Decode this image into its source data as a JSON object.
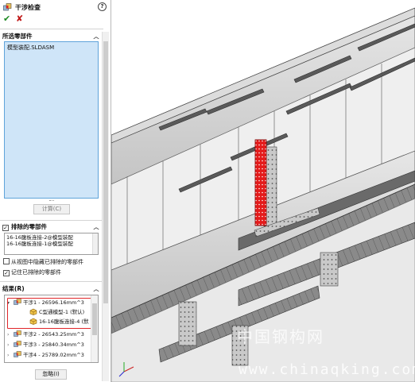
{
  "panel": {
    "title": "干涉检查",
    "help": "?",
    "ok_icon": "check-icon",
    "cancel_icon": "close-icon",
    "selected_parts": {
      "heading": "所选零部件",
      "items": [
        "模型装配.SLDASM"
      ],
      "calc_label": "计算(C)"
    },
    "excluded": {
      "heading": "排除的零部件",
      "checked": true,
      "items": [
        "16-16腹板连接-2@模型装配",
        "16-16腹板连接-1@模型装配"
      ],
      "hide_label": "从视图中隐藏已排除的零部件",
      "hide_checked": false,
      "remember_label": "记住已排除的零部件",
      "remember_checked": true
    },
    "results": {
      "heading": "结果(R)",
      "items": [
        {
          "toggle": "▾",
          "label": "干涉1 - 26596.16mm^3",
          "icon": "interference-icon"
        },
        {
          "toggle": "",
          "label": "C型通模型-1 (默认)",
          "icon": "part-icon"
        },
        {
          "toggle": "",
          "label": "16-16腹板连接-4 (默",
          "icon": "part-icon"
        },
        {
          "toggle": "›",
          "label": "干涉2 - 26543.25mm^3",
          "icon": "interference-icon"
        },
        {
          "toggle": "›",
          "label": "干涉3 - 25840.34mm^3",
          "icon": "interference-icon"
        },
        {
          "toggle": "›",
          "label": "干涉4 - 25789.02mm^3",
          "icon": "interference-icon"
        }
      ],
      "ignore_label": "忽略(I)"
    }
  },
  "viewport": {
    "watermark_cn": "中国钢构网",
    "watermark_url": "www.chinaqking.com"
  },
  "colors": {
    "highlight_red": "#e0262a",
    "selection_blue": "#cfe5f8",
    "interference_red": "#e41b1b",
    "steel_gray": "#cfcfcf",
    "steel_dark": "#5a5a5a"
  }
}
